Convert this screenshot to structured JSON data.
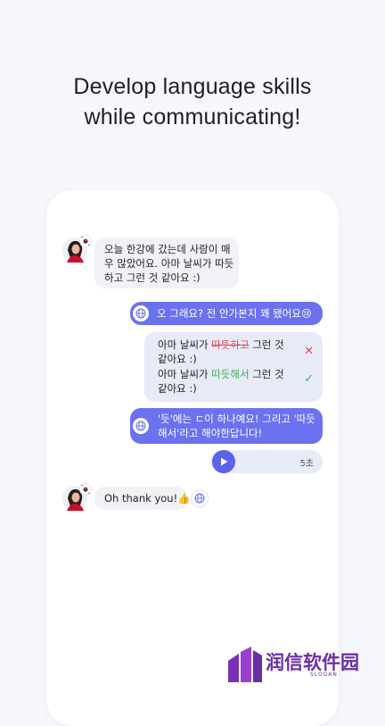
{
  "headline": {
    "line1": "Develop language skills",
    "line2": "while communicating!"
  },
  "chat": {
    "msg1": {
      "lines": [
        "오늘 한강에 갔는데 사람이 매",
        "우 많았어요. 아마 날씨가 따듯",
        "하고 그런 것 같아요 :)"
      ]
    },
    "msg2": {
      "text": "오 그래요? 전 안가본지 꽤 됐어요😢"
    },
    "correction": {
      "wrong_prefix": "아마 날씨가 ",
      "wrong_word": "따뜻하고",
      "wrong_suffix": " 그런 것",
      "wrong_line2": "같아요 :)",
      "right_prefix": "아마 날씨가 ",
      "right_word": "따듯해서",
      "right_suffix": " 그런 것",
      "right_line2": "같아요 :)",
      "wrong_mark": "✕",
      "right_mark": "✓"
    },
    "msg3": {
      "lines": [
        "'듯'에는 ㄷ이 하나예요! 그리고 '따듯",
        "해서'라고 해야한답니다!"
      ]
    },
    "audio": {
      "duration": "5초"
    },
    "msg4": {
      "text": "Oh thank you!👍"
    }
  },
  "icons": {
    "globe": "globe-icon",
    "play": "play-icon",
    "flag": "korea-flag-icon",
    "avatar": "avatar-photo"
  },
  "colors": {
    "accent": "#6a72f0",
    "play": "#5b63e8",
    "wrong": "#e24b4b",
    "right": "#3fae5a",
    "correction_bg": "#e7ebf8"
  },
  "watermark": {
    "text": "润信软件园",
    "sub": "SLOGAN"
  }
}
